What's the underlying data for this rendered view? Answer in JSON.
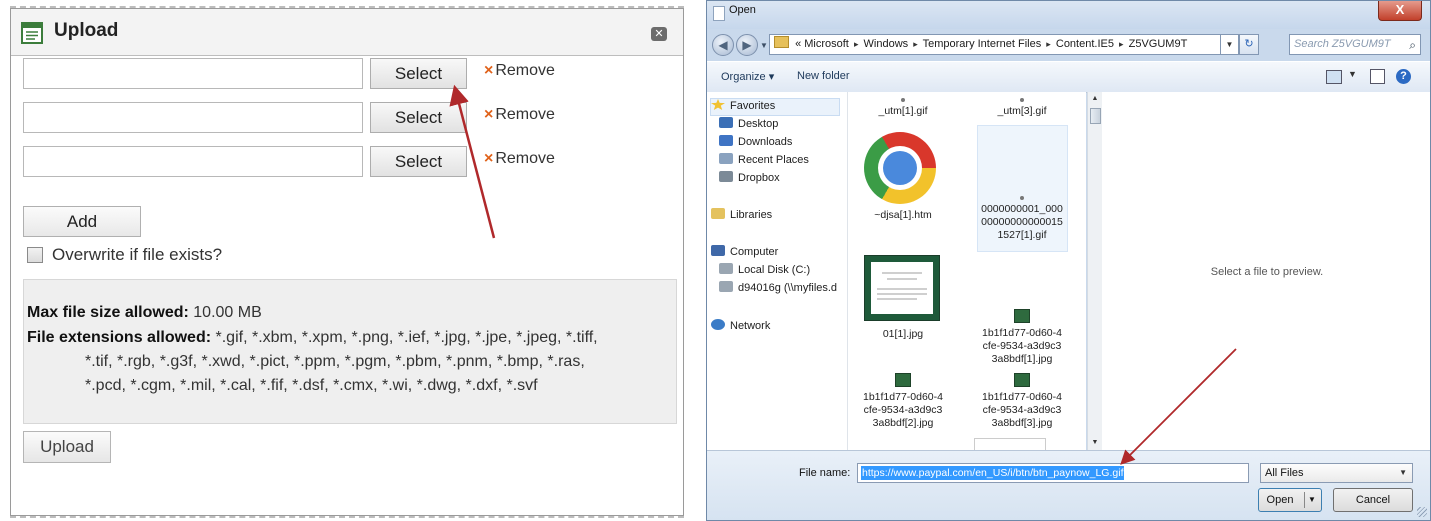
{
  "upload_dialog": {
    "title": "Upload",
    "close_label": "✕",
    "rows": [
      {
        "value": "",
        "select_label": "Select",
        "remove_label": "Remove"
      },
      {
        "value": "",
        "select_label": "Select",
        "remove_label": "Remove"
      },
      {
        "value": "",
        "select_label": "Select",
        "remove_label": "Remove"
      }
    ],
    "remove_icon": "×",
    "add_label": "Add",
    "overwrite_label": "Overwrite if file exists?",
    "overwrite_checked": false,
    "max_size_label": "Max file size allowed:",
    "max_size_value": "10.00 MB",
    "extensions_label": "File extensions allowed:",
    "extensions_line1": "*.gif, *.xbm, *.xpm, *.png, *.ief, *.jpg, *.jpe, *.jpeg, *.tiff,",
    "extensions_line2": "*.tif, *.rgb, *.g3f, *.xwd, *.pict, *.ppm, *.pgm, *.pbm, *.pnm, *.bmp, *.ras,",
    "extensions_line3": "*.pcd, *.cgm, *.mil, *.cal, *.fif, *.dsf, *.cmx, *.wi, *.dwg, *.dxf, *.svf",
    "upload_label": "Upload"
  },
  "open_dialog": {
    "title": "Open",
    "close_label": "X",
    "breadcrumb": {
      "prefix": "«",
      "items": [
        "Microsoft",
        "Windows",
        "Temporary Internet Files",
        "Content.IE5",
        "Z5VGUM9T"
      ],
      "separator": "▸"
    },
    "search_placeholder": "Search Z5VGUM9T",
    "toolbar": {
      "organize": "Organize ▾",
      "new_folder": "New folder"
    },
    "nav": {
      "favorites": "Favorites",
      "desktop": "Desktop",
      "downloads": "Downloads",
      "recent_places": "Recent Places",
      "dropbox": "Dropbox",
      "libraries": "Libraries",
      "computer": "Computer",
      "local_disk": "Local Disk (C:)",
      "network_drive": "d94016g (\\\\myfiles.d",
      "network": "Network"
    },
    "files": {
      "f1": "_utm[1].gif",
      "f2": "_utm[3].gif",
      "f3": "~djsa[1].htm",
      "f4_l1": "0000000001_000",
      "f4_l2": "00000000000015",
      "f4_l3": "1527[1].gif",
      "f5": "01[1].jpg",
      "f6_l1": "1b1f1d77-0d60-4",
      "f6_l2": "cfe-9534-a3d9c3",
      "f6_l3": "3a8bdf[1].jpg",
      "f7_l1": "1b1f1d77-0d60-4",
      "f7_l2": "cfe-9534-a3d9c3",
      "f7_l3": "3a8bdf[2].jpg",
      "f8_l1": "1b1f1d77-0d60-4",
      "f8_l2": "cfe-9534-a3d9c3",
      "f8_l3": "3a8bdf[3].jpg"
    },
    "preview_text": "Select a file to preview.",
    "file_name_label": "File name:",
    "file_name_value": "https://www.paypal.com/en_US/i/btn/btn_paynow_LG.gif",
    "file_type_value": "All Files",
    "open_label": "Open",
    "cancel_label": "Cancel"
  },
  "colors": {
    "annotation_arrow": "#b0292b",
    "remove_x": "#e0621a",
    "selection": "#3399ff"
  },
  "icons": [
    "document-icon",
    "close-icon",
    "remove-x-icon",
    "checkbox-icon",
    "folder-icon",
    "search-icon",
    "refresh-icon",
    "star-icon",
    "chrome-icon",
    "help-icon"
  ]
}
